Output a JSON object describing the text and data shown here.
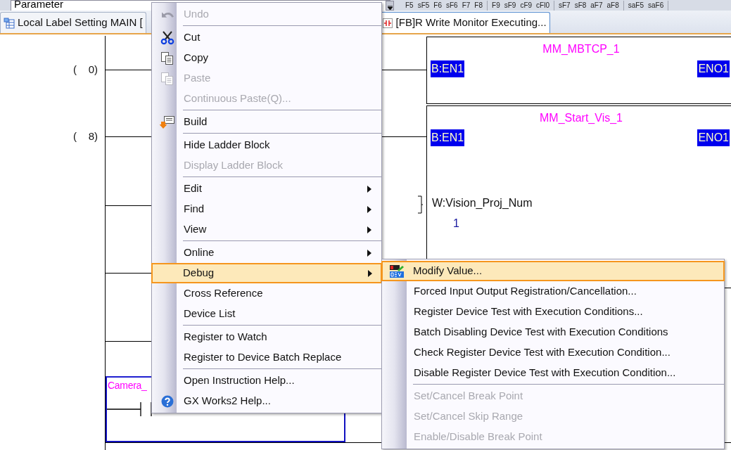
{
  "toolbar": {
    "combo_value": "Parameter",
    "function_key_groups": [
      [
        "F5",
        "sF5",
        "F6",
        "sF6",
        "F7",
        "F8"
      ],
      [
        "F9",
        "sF9",
        "cF9",
        "cFl0"
      ],
      [
        "sF7",
        "sF8",
        "aF7",
        "aF8"
      ],
      [
        "saF5",
        "saF6"
      ]
    ]
  },
  "tabs": [
    {
      "label": "Local Label Setting MAIN [",
      "selected": false
    },
    {
      "label": "[FB]R Write Monitor Executing...",
      "selected": true
    }
  ],
  "ladder": {
    "step_numbers": [
      "(    0)",
      "(    8)"
    ],
    "blocks": [
      {
        "title": "MM_MBTCP_1",
        "input": "B:EN1",
        "output": "ENO1"
      },
      {
        "title": "MM_Start_Vis_1",
        "input": "B:EN1",
        "output": "ENO1"
      }
    ],
    "operand": "W:Vision_Proj_Num",
    "operand_value": "1",
    "contact_label": "Camera_"
  },
  "context_menu": {
    "items": [
      {
        "kind": "item",
        "label": "Undo",
        "disabled": true,
        "selected": false,
        "has_submenu": false
      },
      {
        "kind": "separator"
      },
      {
        "kind": "item",
        "label": "Cut",
        "disabled": false,
        "selected": false,
        "has_submenu": false
      },
      {
        "kind": "item",
        "label": "Copy",
        "disabled": false,
        "selected": false,
        "has_submenu": false
      },
      {
        "kind": "item",
        "label": "Paste",
        "disabled": true,
        "selected": false,
        "has_submenu": false
      },
      {
        "kind": "item",
        "label": "Continuous Paste(Q)...",
        "disabled": true,
        "selected": false,
        "has_submenu": false
      },
      {
        "kind": "separator"
      },
      {
        "kind": "item",
        "label": "Build",
        "disabled": false,
        "selected": false,
        "has_submenu": false
      },
      {
        "kind": "separator"
      },
      {
        "kind": "item",
        "label": "Hide Ladder Block",
        "disabled": false,
        "selected": false,
        "has_submenu": false
      },
      {
        "kind": "item",
        "label": "Display Ladder Block",
        "disabled": true,
        "selected": false,
        "has_submenu": false
      },
      {
        "kind": "separator"
      },
      {
        "kind": "item",
        "label": "Edit",
        "disabled": false,
        "selected": false,
        "has_submenu": true
      },
      {
        "kind": "item",
        "label": "Find",
        "disabled": false,
        "selected": false,
        "has_submenu": true
      },
      {
        "kind": "item",
        "label": "View",
        "disabled": false,
        "selected": false,
        "has_submenu": true
      },
      {
        "kind": "separator"
      },
      {
        "kind": "item",
        "label": "Online",
        "disabled": false,
        "selected": false,
        "has_submenu": true
      },
      {
        "kind": "item",
        "label": "Debug",
        "disabled": false,
        "selected": true,
        "has_submenu": true
      },
      {
        "kind": "item",
        "label": "Cross Reference",
        "disabled": false,
        "selected": false,
        "has_submenu": false
      },
      {
        "kind": "item",
        "label": "Device List",
        "disabled": false,
        "selected": false,
        "has_submenu": false
      },
      {
        "kind": "separator"
      },
      {
        "kind": "item",
        "label": "Register to Watch",
        "disabled": false,
        "selected": false,
        "has_submenu": false
      },
      {
        "kind": "item",
        "label": "Register to Device Batch Replace",
        "disabled": false,
        "selected": false,
        "has_submenu": false
      },
      {
        "kind": "separator"
      },
      {
        "kind": "item",
        "label": "Open Instruction Help...",
        "disabled": false,
        "selected": false,
        "has_submenu": false
      },
      {
        "kind": "item",
        "label": "GX Works2 Help...",
        "disabled": false,
        "selected": false,
        "has_submenu": false
      }
    ]
  },
  "debug_submenu": {
    "items": [
      {
        "kind": "item",
        "label": "Modify Value...",
        "disabled": false,
        "selected": true
      },
      {
        "kind": "item",
        "label": "Forced Input Output Registration/Cancellation...",
        "disabled": false,
        "selected": false
      },
      {
        "kind": "item",
        "label": "Register Device Test with Execution Conditions...",
        "disabled": false,
        "selected": false
      },
      {
        "kind": "item",
        "label": "Batch Disabling Device Test with Execution Conditions",
        "disabled": false,
        "selected": false
      },
      {
        "kind": "item",
        "label": "Check Register Device Test with Execution Condition...",
        "disabled": false,
        "selected": false
      },
      {
        "kind": "item",
        "label": "Disable Register Device Test with Execution Condition...",
        "disabled": false,
        "selected": false
      },
      {
        "kind": "separator"
      },
      {
        "kind": "item",
        "label": "Set/Cancel Break Point",
        "disabled": true,
        "selected": false
      },
      {
        "kind": "item",
        "label": "Set/Cancel Skip Range",
        "disabled": true,
        "selected": false
      },
      {
        "kind": "item",
        "label": "Enable/Disable Break Point",
        "disabled": true,
        "selected": false
      }
    ]
  }
}
